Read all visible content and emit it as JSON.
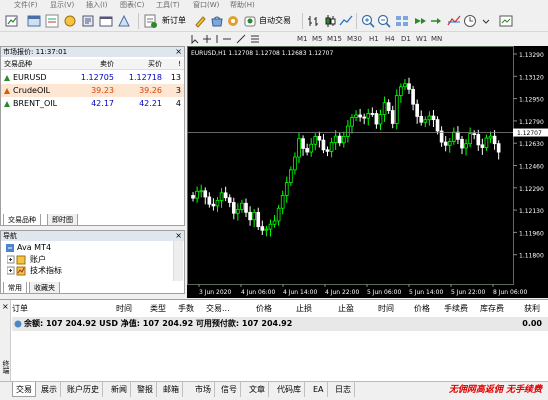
{
  "menu": [
    "文件(F)",
    "显示(V)",
    "插入(I)",
    "图表(C)",
    "工具(T)",
    "窗口(W)",
    "帮助(H)"
  ],
  "toolbar": {
    "new_order": "新订单",
    "auto_trade": "自动交易"
  },
  "timeframes": [
    "M1",
    "M5",
    "M15",
    "M30",
    "H1",
    "H4",
    "D1",
    "W1",
    "MN"
  ],
  "market_watch": {
    "title": "市场报价: 11:37:01",
    "close": "×",
    "headers": {
      "symbol": "交易品种",
      "bid": "卖价",
      "ask": "买价",
      "spread": "!"
    },
    "rows": [
      {
        "symbol": "EURUSD",
        "bid": "1.12705",
        "ask": "1.12718",
        "spread": "13",
        "bg": "#ffffff",
        "color": "#0000c0",
        "icon_color": "#2a8a2a"
      },
      {
        "symbol": "CrudeOIL",
        "bid": "39.23",
        "ask": "39.26",
        "spread": "3",
        "bg": "#fde6d2",
        "color": "#e04000",
        "icon_color": "#d06000"
      },
      {
        "symbol": "BRENT_OIL",
        "bid": "42.17",
        "ask": "42.21",
        "spread": "4",
        "bg": "#ffffff",
        "color": "#0000c0",
        "icon_color": "#2a8a2a"
      }
    ],
    "tabs": [
      "交易品种",
      "即时图"
    ]
  },
  "navigator": {
    "title": "导航",
    "close": "×",
    "root": "Ava MT4",
    "items": [
      "账户",
      "技术指标"
    ],
    "tabs": [
      "常用",
      "收藏夹"
    ]
  },
  "chart": {
    "title": "EURUSD,H1  1.12708 1.12708 1.12683 1.12707",
    "price_ticks": [
      "1.13290",
      "1.13120",
      "1.12950",
      "1.12790",
      "1.12630",
      "1.12460",
      "1.12290",
      "1.12130",
      "1.11960",
      "1.11800"
    ],
    "current_price": "1.12707",
    "time_ticks": [
      "3 Jun 2020",
      "4 Jun 06:00",
      "4 Jun 14:00",
      "4 Jun 22:00",
      "5 Jun 06:00",
      "5 Jun 14:00",
      "5 Jun 22:00",
      "8 Jun 06:00"
    ],
    "colors": {
      "up": "#00ff00",
      "down": "#ffffff",
      "grid": "#5a6a5a",
      "axis_text": "#ffffff",
      "bid_line": "#8a8a8a"
    }
  },
  "terminal": {
    "side_label": "终端",
    "headers": [
      "订单",
      "时间",
      "类型",
      "手数",
      "交易...",
      "价格",
      "止损",
      "止盈",
      "时间",
      "价格",
      "手续费",
      "库存费",
      "获利"
    ],
    "balance": "余额: 107 204.92 USD  净值: 107 204.92  可用预付款: 107 204.92",
    "profit": "0.00"
  },
  "bottom_tabs": [
    "交易",
    "展示",
    "账户历史",
    "新闻",
    "警报",
    "邮箱",
    "市场",
    "信号",
    "文章",
    "代码库",
    "EA",
    "日志"
  ],
  "promo": "无佣网高返佣 无手续费"
}
